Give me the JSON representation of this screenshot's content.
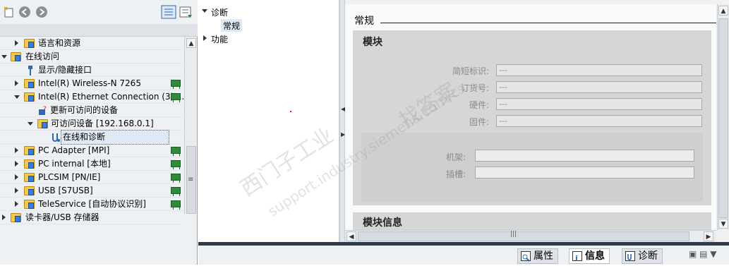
{
  "left_panel": {
    "tree": [
      {
        "label": "语言和资源",
        "expanded": false,
        "level": 2
      },
      {
        "label": "在线访问",
        "expanded": true,
        "level": 0
      },
      {
        "label": "显示/隐藏接口",
        "level": 2
      },
      {
        "label": "Intel(R) Wireless-N 7265",
        "expanded": false,
        "level": 2
      },
      {
        "label": "Intel(R) Ethernet Connection (3) I...",
        "expanded": true,
        "level": 2
      },
      {
        "label": "更新可访问的设备",
        "level": 3
      },
      {
        "label": "可访问设备 [192.168.0.1]",
        "expanded": true,
        "level": 3
      },
      {
        "label": "在线和诊断",
        "level": 4,
        "selected": true
      },
      {
        "label": "PC Adapter [MPI]",
        "expanded": false,
        "level": 2
      },
      {
        "label": "PC internal [本地]",
        "expanded": false,
        "level": 2
      },
      {
        "label": "PLCSIM [PN/IE]",
        "expanded": false,
        "level": 2
      },
      {
        "label": "USB [S7USB]",
        "expanded": false,
        "level": 2
      },
      {
        "label": "TeleService [自动协议识别]",
        "expanded": false,
        "level": 2
      },
      {
        "label": "读卡器/USB 存储器",
        "expanded": false,
        "level": 0
      }
    ]
  },
  "nav_tree": {
    "items": [
      {
        "label": "诊断",
        "expanded": true
      },
      {
        "label": "常规",
        "child": true,
        "selected": true
      },
      {
        "label": "功能",
        "expanded": false
      }
    ]
  },
  "content": {
    "section_title": "常规",
    "module": {
      "title": "模块",
      "fields": [
        {
          "label": "简短标识:",
          "value": "---"
        },
        {
          "label": "订货号:",
          "value": "---"
        },
        {
          "label": "硬件:",
          "value": "---"
        },
        {
          "label": "固件:",
          "value": "---"
        }
      ],
      "rack_label": "机架:",
      "rack_value": "",
      "slot_label": "插槽:",
      "slot_value": ""
    },
    "module_info_title": "模块信息"
  },
  "bottom_tabs": [
    {
      "label": "属性",
      "icon": "properties-icon",
      "active": false
    },
    {
      "label": "信息",
      "icon": "info-icon",
      "active": true
    },
    {
      "label": "诊断",
      "icon": "diagnostics-icon",
      "active": false
    }
  ],
  "watermark": [
    "西门子工业",
    "support.industry.siemens.com/cs",
    "找答案"
  ]
}
